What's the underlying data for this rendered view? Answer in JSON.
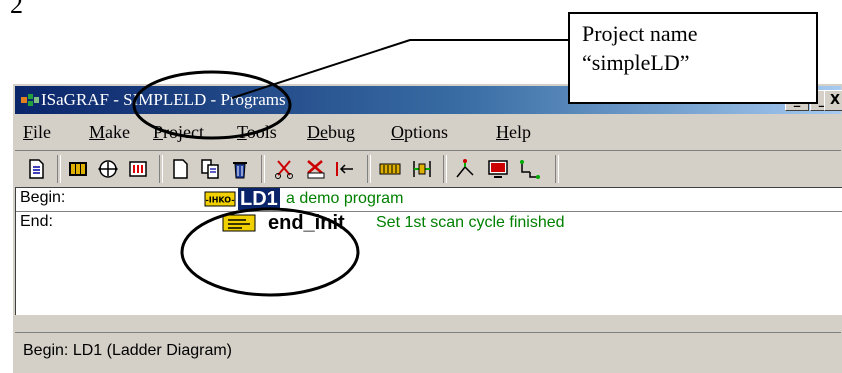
{
  "cutoff_text": "2",
  "callout": {
    "line1": "Project name",
    "line2": "“simpleLD”"
  },
  "window": {
    "title": "ISaGRAF - SIMPLELD - Programs",
    "controls": [
      "_",
      "_",
      "X"
    ]
  },
  "menu": {
    "items": [
      {
        "underlined": "F",
        "rest": "ile"
      },
      {
        "underlined": "M",
        "rest": "ake"
      },
      {
        "underlined": "P",
        "rest": "roject"
      },
      {
        "underlined": "T",
        "rest": "ools"
      },
      {
        "underlined": "De",
        "rest": "bug"
      },
      {
        "underlined": "O",
        "rest": "ptions"
      },
      {
        "underlined": "H",
        "rest": "elp"
      }
    ]
  },
  "toolbar": {
    "icons": [
      "document-icon",
      "dictionary-icon",
      "compile-icon",
      "io-connection-icon",
      "new-program-icon",
      "copy-program-icon",
      "delete-program-icon",
      "cut-icon",
      "verify-icon",
      "move-icon",
      "memory-icon",
      "debug-icon",
      "simulate-icon",
      "monitor-icon",
      "link-icon"
    ]
  },
  "programs": [
    {
      "section": "Begin:",
      "icon": "ld-program-icon",
      "name": "LD1",
      "comment": "a demo program",
      "selected": true
    },
    {
      "section": "End:",
      "icon": "st-program-icon",
      "name": "end_init",
      "comment": "Set 1st scan cycle finished",
      "selected": false
    }
  ],
  "status": {
    "text": "Begin:   LD1   (Ladder Diagram)"
  },
  "colors": {
    "title_bar": "#0a246a",
    "comment": "#008000",
    "selection": "#0a246a",
    "window_face": "#d4d0c8"
  }
}
